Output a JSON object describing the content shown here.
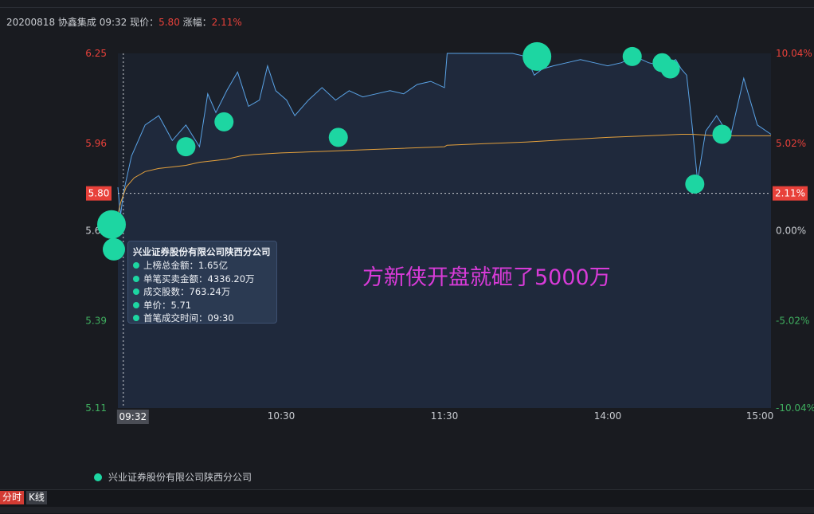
{
  "header": {
    "prefix": "20200818 协鑫集成 09:32 现价：",
    "price": "5.80",
    "change_label": " 涨幅：",
    "change": "2.11%"
  },
  "annotation": "方新侠开盘就砸了5000万",
  "tooltip": {
    "title": "兴业证券股份有限公司陕西分公司",
    "rows": [
      "上榜总金额：1.65亿",
      "单笔买卖金额：4336.20万",
      "成交股数：763.24万",
      "单价：5.71",
      "首笔成交时间：09:30"
    ]
  },
  "legend": {
    "label": "兴业证券股份有限公司陕西分公司"
  },
  "tabs": {
    "fenshi": "分时",
    "kline": "K线"
  },
  "colors": {
    "price_line": "#5aa3e6",
    "avg_line": "#e3a03c",
    "marker": "#1dd6a2",
    "up": "#e8413a",
    "down": "#3fae5f",
    "annotation": "#d83bd8"
  },
  "chart_data": {
    "type": "line",
    "x_domain": [
      "09:30",
      "15:00"
    ],
    "x_ticks": [
      "10:30",
      "11:30",
      "14:00",
      "15:00"
    ],
    "cursor_label": "09:32",
    "price_label": "5.80",
    "change_label": "2.11%",
    "ylim": [
      5.11,
      6.25
    ],
    "y_ticks": [
      {
        "value": 6.25,
        "label": "6.25",
        "pct": "10.04%",
        "color": "up"
      },
      {
        "value": 5.96,
        "label": "5.96",
        "pct": "5.02%",
        "color": "up"
      },
      {
        "value": 5.68,
        "label": "5.68",
        "pct": "0.00%",
        "color": "flat"
      },
      {
        "value": 5.39,
        "label": "5.39",
        "pct": "-5.02%",
        "color": "down"
      },
      {
        "value": 5.11,
        "label": "5.11",
        "pct": "-10.04%",
        "color": "down"
      }
    ],
    "series": [
      {
        "key": "price",
        "x": [
          "09:30",
          "09:31",
          "09:32",
          "09:35",
          "09:40",
          "09:45",
          "09:50",
          "09:55",
          "10:00",
          "10:03",
          "10:06",
          "10:10",
          "10:14",
          "10:18",
          "10:22",
          "10:25",
          "10:28",
          "10:32",
          "10:35",
          "10:40",
          "10:45",
          "10:50",
          "10:55",
          "11:00",
          "11:05",
          "11:10",
          "11:15",
          "11:20",
          "11:25",
          "11:30",
          "13:01",
          "13:05",
          "13:10",
          "13:15",
          "13:20",
          "13:25",
          "13:30",
          "13:33",
          "13:36",
          "13:40",
          "13:45",
          "13:50",
          "13:55",
          "14:00",
          "14:05",
          "14:10",
          "14:15",
          "14:20",
          "14:25",
          "14:27",
          "14:29",
          "14:31",
          "14:33",
          "14:36",
          "14:40",
          "14:45",
          "14:50",
          "14:55",
          "15:00"
        ],
        "values": [
          5.82,
          5.73,
          5.8,
          5.92,
          6.02,
          6.05,
          5.97,
          6.02,
          5.95,
          6.12,
          6.06,
          6.13,
          6.19,
          6.08,
          6.1,
          6.21,
          6.13,
          6.1,
          6.05,
          6.1,
          6.14,
          6.1,
          6.13,
          6.11,
          6.12,
          6.13,
          6.12,
          6.15,
          6.16,
          6.14,
          6.25,
          6.25,
          6.25,
          6.25,
          6.25,
          6.25,
          6.24,
          6.18,
          6.2,
          6.21,
          6.22,
          6.23,
          6.22,
          6.21,
          6.22,
          6.24,
          6.22,
          6.21,
          6.23,
          6.2,
          6.18,
          6.02,
          5.84,
          6.0,
          6.05,
          5.98,
          6.17,
          6.02,
          5.99
        ]
      },
      {
        "key": "avg",
        "x": [
          "09:30",
          "09:31",
          "09:33",
          "09:36",
          "09:40",
          "09:45",
          "09:50",
          "09:55",
          "10:00",
          "10:10",
          "10:15",
          "10:20",
          "10:30",
          "10:45",
          "11:00",
          "11:15",
          "11:30",
          "13:01",
          "13:15",
          "13:30",
          "13:40",
          "14:00",
          "14:15",
          "14:27",
          "14:31",
          "14:40",
          "14:50",
          "15:00"
        ],
        "values": [
          5.73,
          5.77,
          5.82,
          5.85,
          5.87,
          5.88,
          5.885,
          5.89,
          5.9,
          5.91,
          5.92,
          5.925,
          5.93,
          5.935,
          5.94,
          5.945,
          5.95,
          5.955,
          5.96,
          5.965,
          5.97,
          5.98,
          5.985,
          5.99,
          5.99,
          5.985,
          5.985,
          5.985
        ]
      }
    ],
    "markers": {
      "name": "兴业证券股份有限公司陕西分公司",
      "points": [
        {
          "x": "09:30",
          "y": 5.7,
          "size": "large"
        },
        {
          "x": "09:30",
          "y": 5.62,
          "size": "medium"
        },
        {
          "x": "09:55",
          "y": 5.95,
          "size": "small"
        },
        {
          "x": "10:09",
          "y": 6.03,
          "size": "small"
        },
        {
          "x": "10:51",
          "y": 5.98,
          "size": "small"
        },
        {
          "x": "13:34",
          "y": 6.24,
          "size": "large"
        },
        {
          "x": "14:09",
          "y": 6.24,
          "size": "small"
        },
        {
          "x": "14:20",
          "y": 6.22,
          "size": "small"
        },
        {
          "x": "14:23",
          "y": 6.2,
          "size": "small"
        },
        {
          "x": "14:32",
          "y": 5.83,
          "size": "small"
        },
        {
          "x": "14:42",
          "y": 5.99,
          "size": "small"
        }
      ]
    }
  }
}
